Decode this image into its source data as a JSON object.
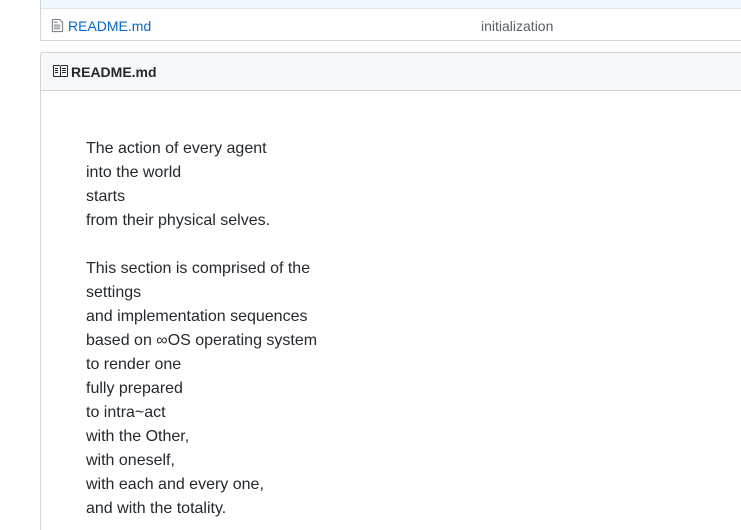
{
  "file_list": {
    "rows": [
      {
        "name": "README.md",
        "icon": "file-text-icon",
        "commit_message": "initialization"
      }
    ]
  },
  "readme": {
    "icon": "book-icon",
    "title": "README.md",
    "paragraphs": [
      {
        "lines": [
          "The action of every agent",
          "into the world",
          "starts",
          "from their physical selves."
        ]
      },
      {
        "lines": [
          "This section is comprised of the",
          "settings",
          "and implementation sequences",
          "based on ∞OS operating system",
          "to render one",
          "fully prepared",
          "to intra~act",
          "with the Other,",
          "with oneself,",
          "with each and every one,",
          "and with the totality."
        ]
      }
    ]
  },
  "colors": {
    "link": "#0366d6",
    "muted_text": "#586069",
    "border": "#d1d5da",
    "header_bg": "#f6f8fa"
  }
}
